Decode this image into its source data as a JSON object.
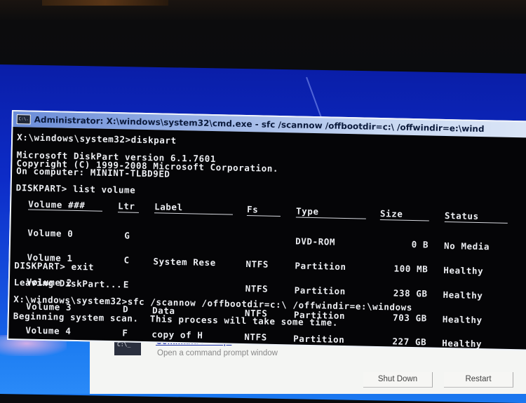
{
  "window": {
    "title": "Administrator: X:\\windows\\system32\\cmd.exe - sfc  /scannow /offbootdir=c:\\ /offwindir=e:\\wind",
    "icon": "console-icon",
    "icon_text": "C:\\."
  },
  "console": {
    "lines": {
      "cmd1": "X:\\windows\\system32>diskpart",
      "ver": "Microsoft DiskPart version 6.1.7601",
      "copy": "Copyright (C) 1999-2008 Microsoft Corporation.",
      "comp": "On computer: MININT-TLBD9ED",
      "cmd2": "DISKPART> list volume",
      "cmd3": "DISKPART> exit",
      "leave": "Leaving DiskPart...",
      "cmd4": "X:\\windows\\system32>sfc /scannow /offbootdir=c:\\ /offwindir=e:\\windows",
      "scan": "Beginning system scan.  This process will take some time."
    },
    "volume_table": {
      "headers": [
        "Volume ###",
        "Ltr",
        "Label",
        "Fs",
        "Type",
        "Size",
        "Status"
      ],
      "rows": [
        {
          "volume": "Volume 0",
          "ltr": "G",
          "label": "",
          "fs": "",
          "type": "DVD-ROM",
          "size": "0 B",
          "status": "No Media"
        },
        {
          "volume": "Volume 1",
          "ltr": "C",
          "label": "System Rese",
          "fs": "NTFS",
          "type": "Partition",
          "size": "100 MB",
          "status": "Healthy"
        },
        {
          "volume": "Volume 2",
          "ltr": "E",
          "label": "",
          "fs": "NTFS",
          "type": "Partition",
          "size": "238 GB",
          "status": "Healthy"
        },
        {
          "volume": "Volume 3",
          "ltr": "D",
          "label": "Data",
          "fs": "NTFS",
          "type": "Partition",
          "size": "703 GB",
          "status": "Healthy"
        },
        {
          "volume": "Volume 4",
          "ltr": "F",
          "label": "copy of H",
          "fs": "NTFS",
          "type": "Partition",
          "size": "227 GB",
          "status": "Healthy"
        }
      ]
    }
  },
  "recovery_dialog": {
    "item_icon_text": "C:\\_",
    "item_title": "Command Prompt",
    "item_description": "Open a command prompt window",
    "shutdown_label": "Shut Down",
    "restart_label": "Restart"
  }
}
